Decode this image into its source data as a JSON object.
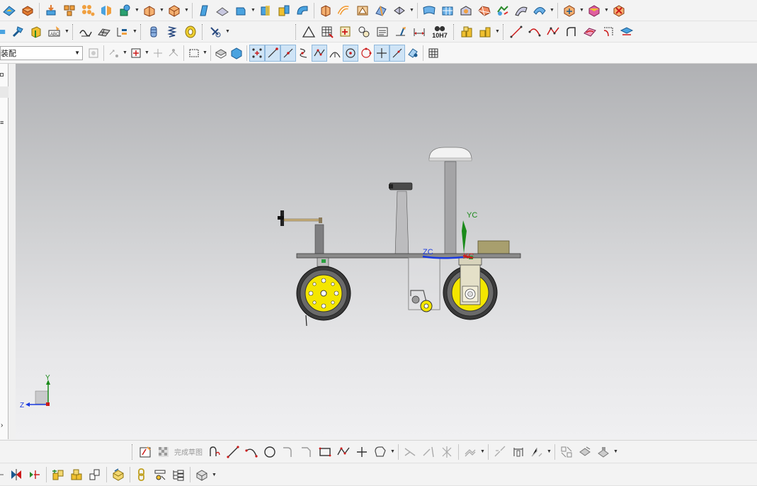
{
  "assembly_combo": {
    "value": "装配"
  },
  "sketch_toolbar": {
    "finish_sketch_label": "完成草图"
  },
  "tolerance_icon_text": "10H7",
  "viewport": {
    "wcs_labels": {
      "yc": "YC",
      "zc": "ZC",
      "xc": "XC"
    },
    "triad_labels": {
      "y": "Y",
      "z": "Z"
    }
  },
  "colors": {
    "wheel_hub": "#f4e600",
    "tire": "#3a3a3a",
    "platform": "#8a8a8a",
    "box": "#a89f6e",
    "yc_axis": "#1a8a1a",
    "zc_axis": "#1a3adf",
    "xc_axis": "#cc1a1a"
  }
}
